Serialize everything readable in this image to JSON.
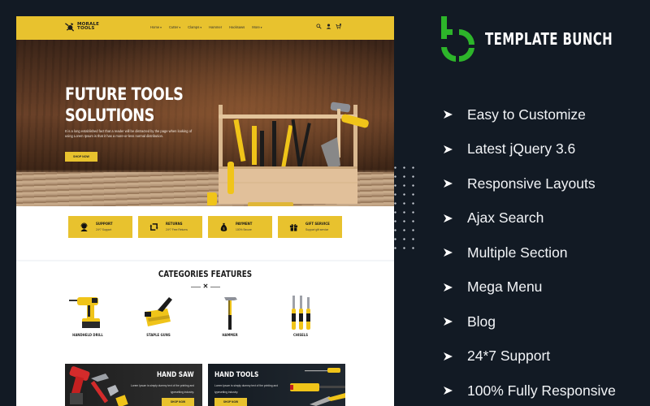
{
  "colors": {
    "page_bg": "#121a24",
    "accent_yellow": "#e8c22e",
    "brand_green": "#2db52a",
    "text_white": "#f2f4f7"
  },
  "preview": {
    "header": {
      "logo_line1": "MORALE",
      "logo_line2": "TOOLS",
      "nav": [
        {
          "label": "Home",
          "has_dropdown": true
        },
        {
          "label": "Cutter",
          "has_dropdown": true
        },
        {
          "label": "Clamps",
          "has_dropdown": true
        },
        {
          "label": "Hammer",
          "has_dropdown": false
        },
        {
          "label": "Hacksaws",
          "has_dropdown": false
        },
        {
          "label": "More",
          "has_dropdown": true
        }
      ],
      "icons": [
        "search-icon",
        "user-icon",
        "cart-icon"
      ],
      "cart_count": "0"
    },
    "hero": {
      "title_line1": "FUTURE TOOLS",
      "title_line2": "SOLUTIONS",
      "description": "It is a long established fact that a reader will be distracted by the page when looking of using Lorem Ipsum is that it has a more-or-less normal distribution.",
      "button": "SHOP NOW"
    },
    "services": [
      {
        "icon": "headset-icon",
        "title": "SUPPORT",
        "subtitle": "24*7 Support"
      },
      {
        "icon": "returns-icon",
        "title": "RETURNS",
        "subtitle": "24*7 Free Returns"
      },
      {
        "icon": "money-bag-icon",
        "title": "PAYMENT",
        "subtitle": "100% Secure"
      },
      {
        "icon": "gift-icon",
        "title": "GIFT SERVICE",
        "subtitle": "Support gift service"
      }
    ],
    "categories": {
      "title": "CATEGORIES FEATURES",
      "items": [
        {
          "label": "HANDHELD DRILL"
        },
        {
          "label": "STAPLE GUNS"
        },
        {
          "label": "HAMMER"
        },
        {
          "label": "CHISELS"
        }
      ]
    },
    "banners": [
      {
        "title": "HAND SAW",
        "text": "Lorem Ipsum is simply dummy text of the printing and typesetting industry.",
        "button": "SHOP NOW"
      },
      {
        "title": "HAND TOOLS",
        "text": "Lorem Ipsum is simply dummy text of the printing and typesetting industry.",
        "button": "SHOP NOW"
      }
    ]
  },
  "brand": {
    "name": "TEMPLATE BUNCH"
  },
  "features": [
    {
      "label": "Easy to Customize"
    },
    {
      "label": "Latest jQuery 3.6"
    },
    {
      "label": "Responsive Layouts"
    },
    {
      "label": "Ajax Search"
    },
    {
      "label": "Multiple Section"
    },
    {
      "label": "Mega Menu"
    },
    {
      "label": "Blog"
    },
    {
      "label": "24*7 Support"
    },
    {
      "label": "100% Fully Responsive"
    }
  ]
}
